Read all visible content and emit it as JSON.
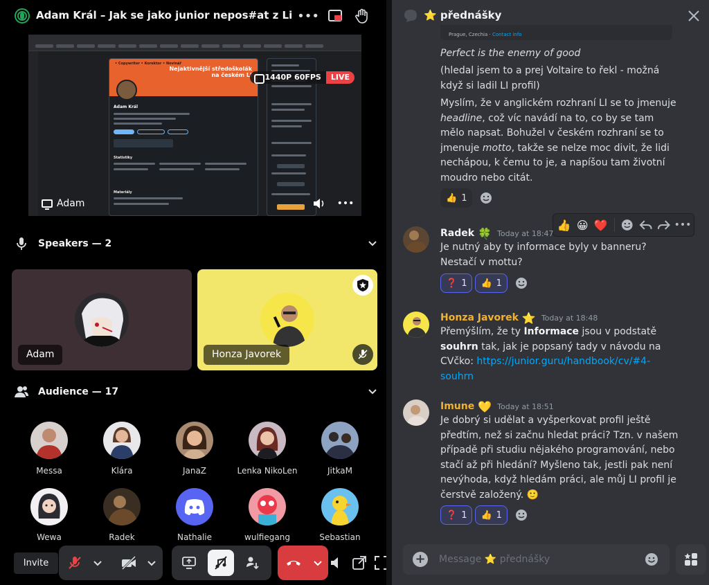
{
  "stage": {
    "title": "Adam Král – Jak se jako junior nepos#at z LinkedInu a r",
    "stream": {
      "quality": "1440P 60FPS",
      "live": "LIVE",
      "streamer": "Adam",
      "linkedin_banner_tag": "• Copywriter • Korektor • Novinář",
      "linkedin_banner": "Nejaktivnější středoškolák na českém LI",
      "linkedin_name": "Adam Král"
    },
    "speakers": {
      "title": "Speakers — 2",
      "items": [
        {
          "name": "Adam",
          "bg": "#3d2f34"
        },
        {
          "name": "Honza Javorek",
          "bg": "#f2e66b"
        }
      ]
    },
    "audience": {
      "title": "Audience — 17",
      "members": [
        {
          "name": "Messa",
          "color": "#b85a4a"
        },
        {
          "name": "Klára",
          "color": "#3a4b6a"
        },
        {
          "name": "JanaZ",
          "color": "#c89a78"
        },
        {
          "name": "Lenka NikoLen",
          "color": "#8a3b44"
        },
        {
          "name": "JitkaM",
          "color": "#5a6a8a"
        },
        {
          "name": "Wewa",
          "color": "#e9e6ee"
        },
        {
          "name": "Radek",
          "color": "#5a4632"
        },
        {
          "name": "Nathalie",
          "color": "#5865f2"
        },
        {
          "name": "wulfiegang",
          "color": "#e25d6a"
        },
        {
          "name": "Sebastian",
          "color": "#5bb5e8"
        }
      ]
    },
    "controls": {
      "invite": "Invite"
    }
  },
  "chat": {
    "title": "⭐ přednášky",
    "embed_stub": {
      "location": "Prague, Czechia",
      "link": "Contact info"
    },
    "first_message": {
      "quote": "Perfect is the enemy of good",
      "p1": "(hledal jsem to a prej Voltaire to řekl - možná když si ladil LI profil)",
      "p2_a": "Myslím, že v anglickém rozhraní LI se to jmenuje ",
      "p2_em1": "headline",
      "p2_b": ", což víc navádí na to, co by se tam mělo napsat. Bohužel v českém rozhraní se to jmenuje ",
      "p2_em2": "motto",
      "p2_c": ", takže se nelze moc divit, že lidi nechápou, k čemu to je, a napíšou tam životní moudro nebo citát.",
      "reactions": [
        {
          "emoji": "👍",
          "count": "1",
          "me": false
        }
      ]
    },
    "messages": [
      {
        "author": "Radek",
        "author_badge": "🍀",
        "author_color": "#f2f3f5",
        "time": "Today at 18:47",
        "text": "Je nutný aby ty informace byly v banneru? Nestačí v mottu?",
        "reactions": [
          {
            "emoji": "❓",
            "count": "1",
            "me": true
          },
          {
            "emoji": "👍",
            "count": "1",
            "me": true
          }
        ]
      },
      {
        "author": "Honza Javorek",
        "author_badge": "⭐",
        "author_color": "#f0b232",
        "time": "Today at 18:48",
        "t1": "Přemýšlím, že ty ",
        "b1": "Informace",
        "t2": " jsou v podstatě ",
        "b2": "souhrn",
        "t3": " tak, jak je popsaný tady v návodu na CVčko: ",
        "link": "https://junior.guru/handbook/cv/#4-souhrn"
      },
      {
        "author": "Imune",
        "author_badge": "💛",
        "author_color": "#f0b232",
        "time": "Today at 18:51",
        "text": "Je dobrý si udělat a vyšperkovat profil ještě předtím, než si začnu hledat práci? Tzn. v našem případě při studiu nějakého programování, nebo stačí až při hledání? Myšleno tak, jestli pak není nevýhoda, když hledám práci, ale můj LI profil je čerstvě založený. 🙂",
        "reactions": [
          {
            "emoji": "❓",
            "count": "1",
            "me": true
          },
          {
            "emoji": "👍",
            "count": "1",
            "me": true
          }
        ]
      }
    ],
    "hover_actions": [
      "👍",
      "😀",
      "❤️"
    ],
    "composer_placeholder": "Message ⭐ přednášky"
  }
}
